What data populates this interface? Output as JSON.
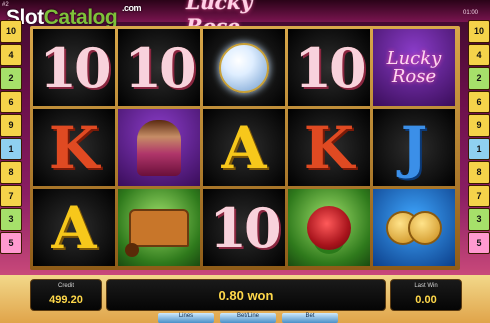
{
  "header": {
    "game_number": "#2",
    "clock": "01:00",
    "logo_text": "Lucky Rose"
  },
  "watermark": {
    "part1": "Slot",
    "part2": "Catalog",
    "suffix": ".com"
  },
  "paylines_left": [
    "10",
    "4",
    "2",
    "6",
    "9",
    "1",
    "8",
    "7",
    "3",
    "5"
  ],
  "paylines_right": [
    "10",
    "4",
    "2",
    "6",
    "9",
    "1",
    "8",
    "7",
    "3",
    "5"
  ],
  "payline_colors": [
    "#f5d34a",
    "#f5d34a",
    "#a6e06a",
    "#f5d34a",
    "#f5d34a",
    "#8fd0f0",
    "#f5d34a",
    "#f5d34a",
    "#a6e06a",
    "#ff9ad0"
  ],
  "reels": [
    [
      {
        "sym": "10",
        "bg": "c-dark",
        "name": "ten-symbol"
      },
      {
        "sym": "K",
        "bg": "c-dark",
        "name": "king-symbol"
      },
      {
        "sym": "A",
        "bg": "c-dark",
        "name": "ace-symbol"
      }
    ],
    [
      {
        "sym": "10",
        "bg": "c-dark",
        "name": "ten-symbol"
      },
      {
        "sym": "lady",
        "bg": "c-purple",
        "name": "fortune-teller-symbol"
      },
      {
        "sym": "wagon",
        "bg": "c-green",
        "name": "gypsy-wagon-symbol"
      }
    ],
    [
      {
        "sym": "orb",
        "bg": "c-dark",
        "name": "crystal-ball-symbol"
      },
      {
        "sym": "A",
        "bg": "c-dark",
        "name": "ace-symbol"
      },
      {
        "sym": "10",
        "bg": "c-dark",
        "name": "ten-symbol"
      }
    ],
    [
      {
        "sym": "10",
        "bg": "c-dark",
        "name": "ten-symbol"
      },
      {
        "sym": "K",
        "bg": "c-dark",
        "name": "king-symbol"
      },
      {
        "sym": "rose",
        "bg": "c-green",
        "name": "rose-symbol"
      }
    ],
    [
      {
        "sym": "lucky",
        "bg": "c-purple",
        "name": "lucky-rose-wild-symbol"
      },
      {
        "sym": "J",
        "bg": "c-dark",
        "name": "jack-symbol"
      },
      {
        "sym": "coins",
        "bg": "c-blue",
        "name": "gold-coins-symbol"
      }
    ]
  ],
  "credit": {
    "label": "Credit",
    "value": "499.20"
  },
  "win_message": "0.80 won",
  "last_win": {
    "label": "Last Win",
    "value": "0.00"
  },
  "controls": {
    "lines_label": "Lines",
    "bet_line_label": "Bet/Line",
    "bet_label": "Bet"
  }
}
